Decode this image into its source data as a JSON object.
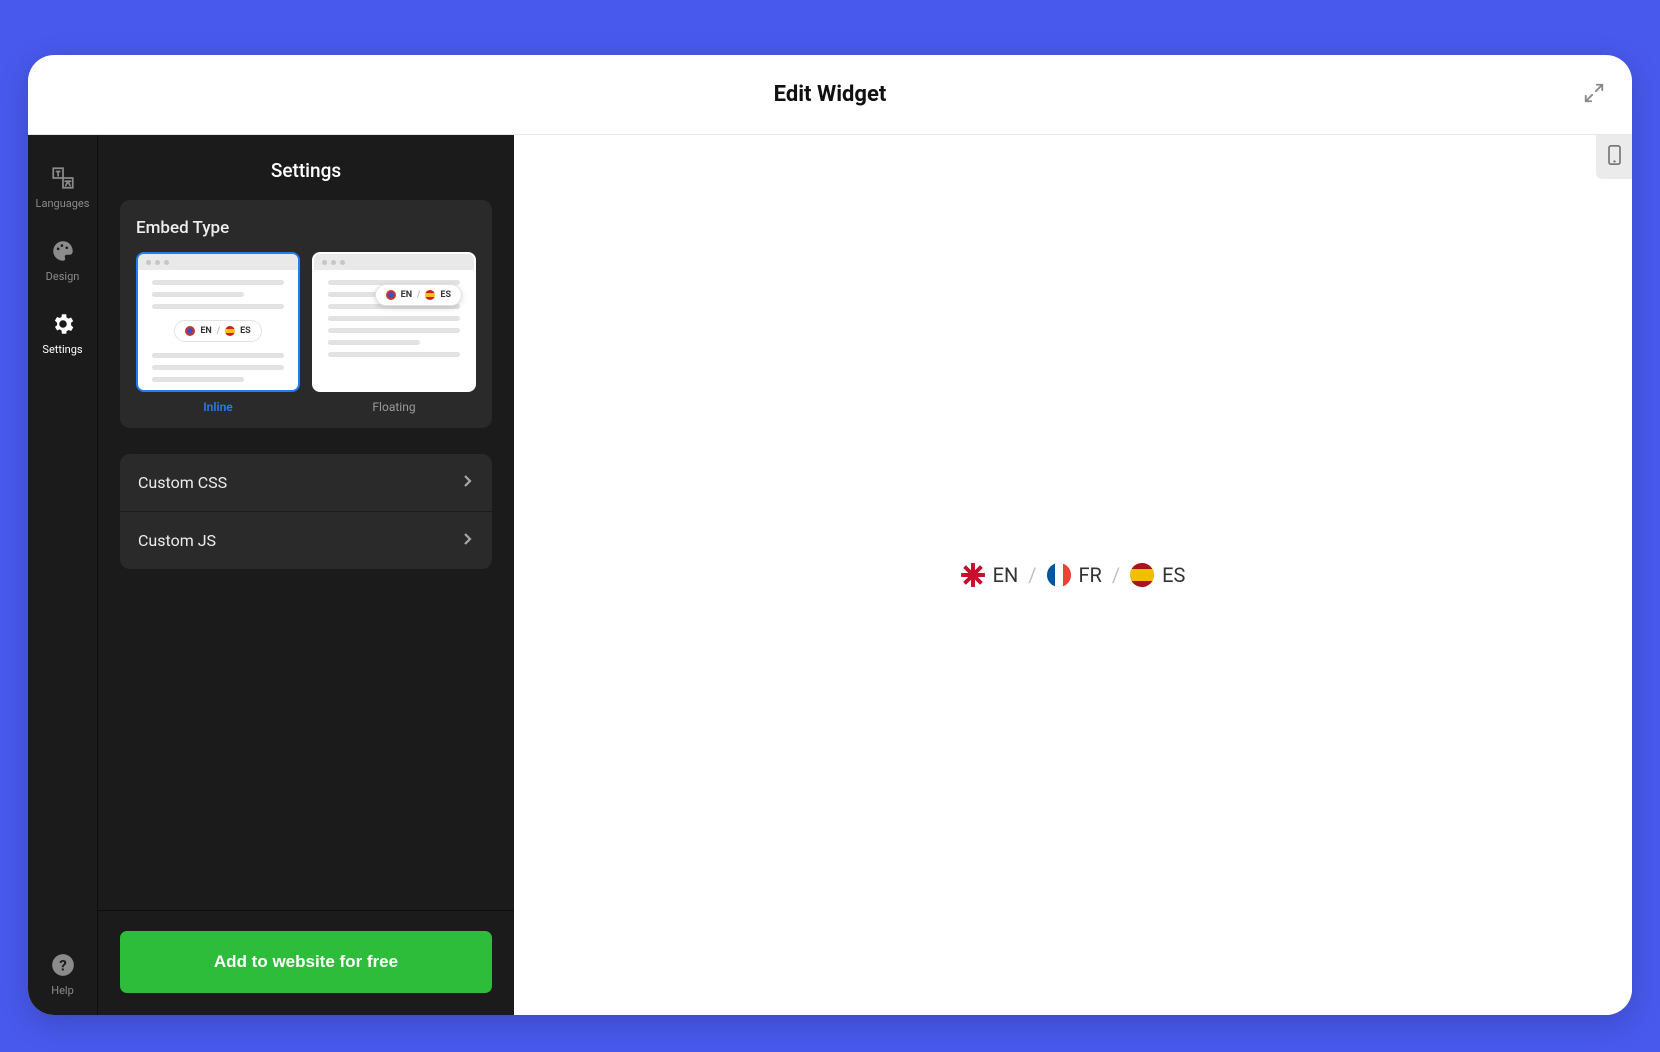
{
  "modal": {
    "title": "Edit Widget"
  },
  "rail": {
    "items": [
      {
        "label": "Languages",
        "active": false
      },
      {
        "label": "Design",
        "active": false
      },
      {
        "label": "Settings",
        "active": true
      }
    ],
    "help_label": "Help"
  },
  "panel": {
    "title": "Settings",
    "embed": {
      "title": "Embed Type",
      "options": [
        {
          "label": "Inline",
          "active": true,
          "pill_l": "EN",
          "pill_r": "ES"
        },
        {
          "label": "Floating",
          "active": false,
          "pill_l": "EN",
          "pill_r": "ES"
        }
      ]
    },
    "rows": [
      {
        "label": "Custom CSS"
      },
      {
        "label": "Custom JS"
      }
    ],
    "cta": "Add to website for free"
  },
  "preview": {
    "separator": "/",
    "languages": [
      {
        "code": "EN",
        "flag": "uk"
      },
      {
        "code": "FR",
        "flag": "fr"
      },
      {
        "code": "ES",
        "flag": "es"
      }
    ]
  }
}
